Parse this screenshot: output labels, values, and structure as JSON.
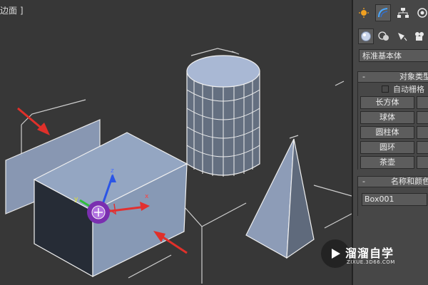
{
  "viewport": {
    "label": "边面 ]"
  },
  "command_panel": {
    "tabs": [
      {
        "icon": "sun-icon",
        "active": false
      },
      {
        "icon": "modify-arc-icon",
        "active": true
      },
      {
        "icon": "hierarchy-icon",
        "active": false
      },
      {
        "icon": "motion-icon",
        "active": false
      }
    ],
    "categories": [
      {
        "icon": "sphere-geometry-icon",
        "active": true
      },
      {
        "icon": "shapes-icon",
        "active": false
      },
      {
        "icon": "light-icon",
        "active": false
      },
      {
        "icon": "camera-icon",
        "active": false
      }
    ],
    "dropdown_value": "标准基本体",
    "object_type": {
      "header": "对象类型",
      "minus": "-",
      "autogrid_label": "自动栅格",
      "buttons": [
        "长方体",
        "球体",
        "圆柱体",
        "圆环",
        "茶壶"
      ]
    },
    "name_color": {
      "header": "名称和颜色",
      "minus": "-",
      "name_value": "Box001"
    }
  },
  "watermark": {
    "title": "溜溜自学",
    "url": "ZIXUE.3D66.COM"
  },
  "colors": {
    "viewport_bg": "#373737",
    "panel_bg": "#474747",
    "annotation_arrow": "#e0302a",
    "object_fill": "#8a9bb6",
    "gizmo_purple": "#7a2fb0"
  }
}
